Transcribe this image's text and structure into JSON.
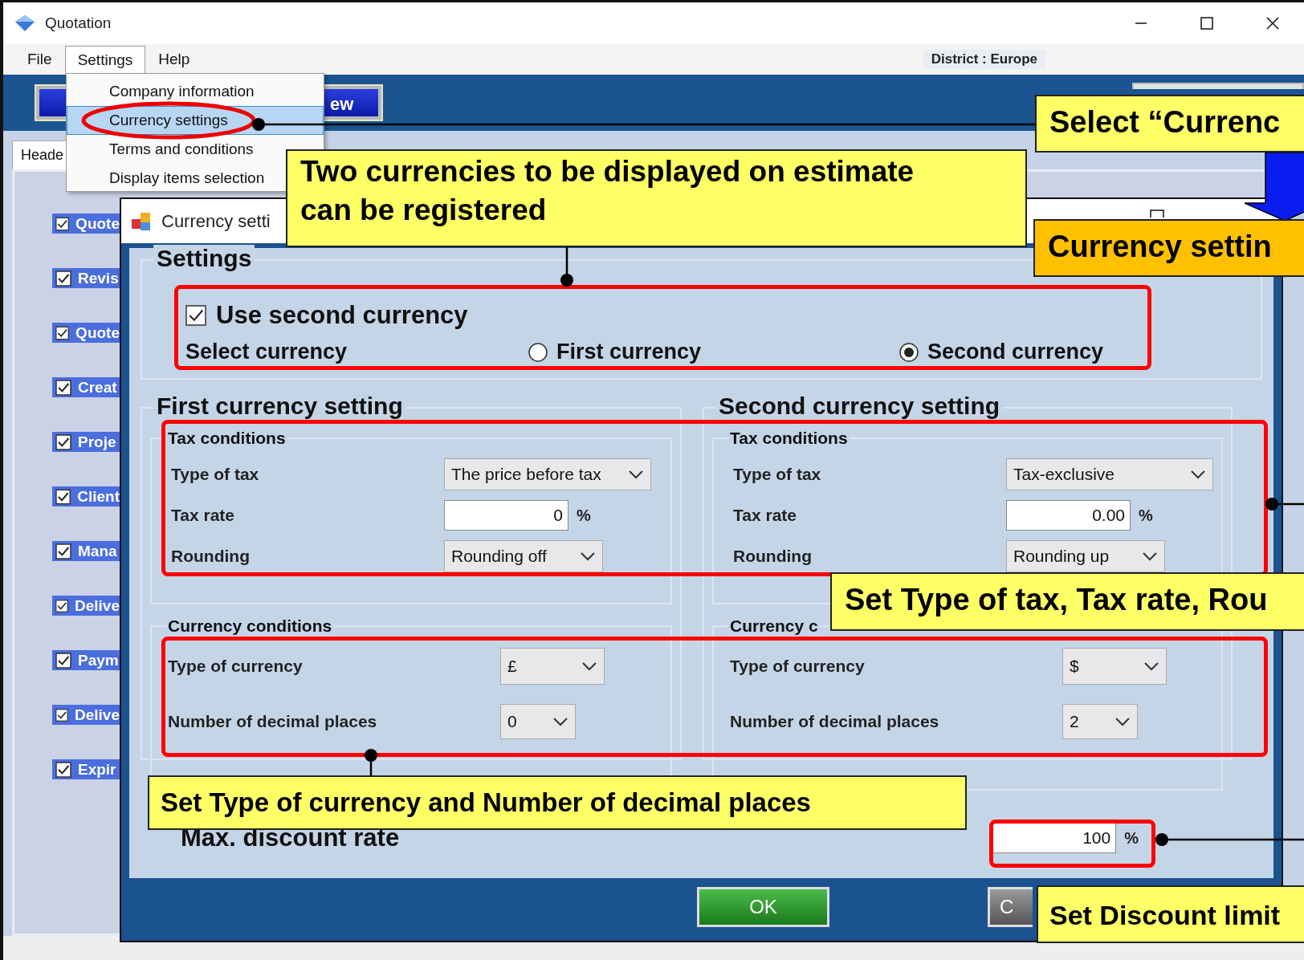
{
  "window": {
    "title": "Quotation"
  },
  "menu": [
    {
      "label": "File",
      "selected": false
    },
    {
      "label": "Settings",
      "selected": true
    },
    {
      "label": "Help",
      "selected": false
    }
  ],
  "district": "District : Europe",
  "toolbar_button": "ew",
  "tabs": [
    {
      "label": "Heade",
      "selected": true
    }
  ],
  "settings_menu": [
    {
      "label": "Company information",
      "selected": false
    },
    {
      "label": "Currency settings",
      "selected": true
    },
    {
      "label": "Terms and conditions",
      "selected": false
    },
    {
      "label": "Display items selection",
      "selected": false
    }
  ],
  "sidebar_items": [
    {
      "label": "Quote",
      "checked": true
    },
    {
      "label": "Revis",
      "checked": true
    },
    {
      "label": "Quote",
      "checked": true
    },
    {
      "label": "Creat",
      "checked": true
    },
    {
      "label": "Proje",
      "checked": true
    },
    {
      "label": "Client",
      "checked": true
    },
    {
      "label": "Mana",
      "checked": true
    },
    {
      "label": "Delive",
      "checked": true
    },
    {
      "label": "Paym",
      "checked": true
    },
    {
      "label": "Delive",
      "checked": true
    },
    {
      "label": "Expir",
      "checked": true
    }
  ],
  "dialog": {
    "title": "Currency setti",
    "settings": {
      "heading": "Settings",
      "use_second_currency": {
        "label": "Use second currency",
        "checked": true
      },
      "select_label": "Select currency",
      "options": [
        {
          "label": "First currency",
          "selected": false
        },
        {
          "label": "Second currency",
          "selected": true
        }
      ]
    },
    "currencies": [
      {
        "heading": "First currency setting",
        "tax_heading": "Tax conditions",
        "type_of_tax_label": "Type of tax",
        "type_of_tax": "The price before tax",
        "tax_rate_label": "Tax rate",
        "tax_rate": "0",
        "tax_unit": "%",
        "rounding_label": "Rounding",
        "rounding": "Rounding off",
        "currency_heading": "Currency conditions",
        "currency_type_label": "Type of currency",
        "currency_type": "£",
        "decimals_label": "Number of decimal places",
        "decimals": "0"
      },
      {
        "heading": "Second currency setting",
        "tax_heading": "Tax conditions",
        "type_of_tax_label": "Type of tax",
        "type_of_tax": "Tax-exclusive",
        "tax_rate_label": "Tax rate",
        "tax_rate": "0.00",
        "tax_unit": "%",
        "rounding_label": "Rounding",
        "rounding": "Rounding up",
        "currency_heading": "Currency c",
        "currency_type_label": "Type of currency",
        "currency_type": "$",
        "decimals_label": "Number of decimal places",
        "decimals": "2"
      }
    ],
    "max_discount": {
      "label": "Max. discount rate",
      "value": "100",
      "unit": "%"
    },
    "buttons": [
      {
        "label": "OK",
        "kind": "ok"
      },
      {
        "label": "C",
        "kind": "cancel"
      }
    ]
  },
  "callouts": [
    {
      "text": "Select “Currenc",
      "kind": "note"
    },
    {
      "text": "Currency settin",
      "kind": "heading"
    },
    {
      "text": "Two currencies to be displayed on estimate can be registered",
      "kind": "note"
    },
    {
      "text": "Set Type of tax, Tax rate, Rou",
      "kind": "note"
    },
    {
      "text": "Set Type of currency and Number of decimal places",
      "kind": "note"
    },
    {
      "text": "Set Discount limit",
      "kind": "note"
    }
  ]
}
